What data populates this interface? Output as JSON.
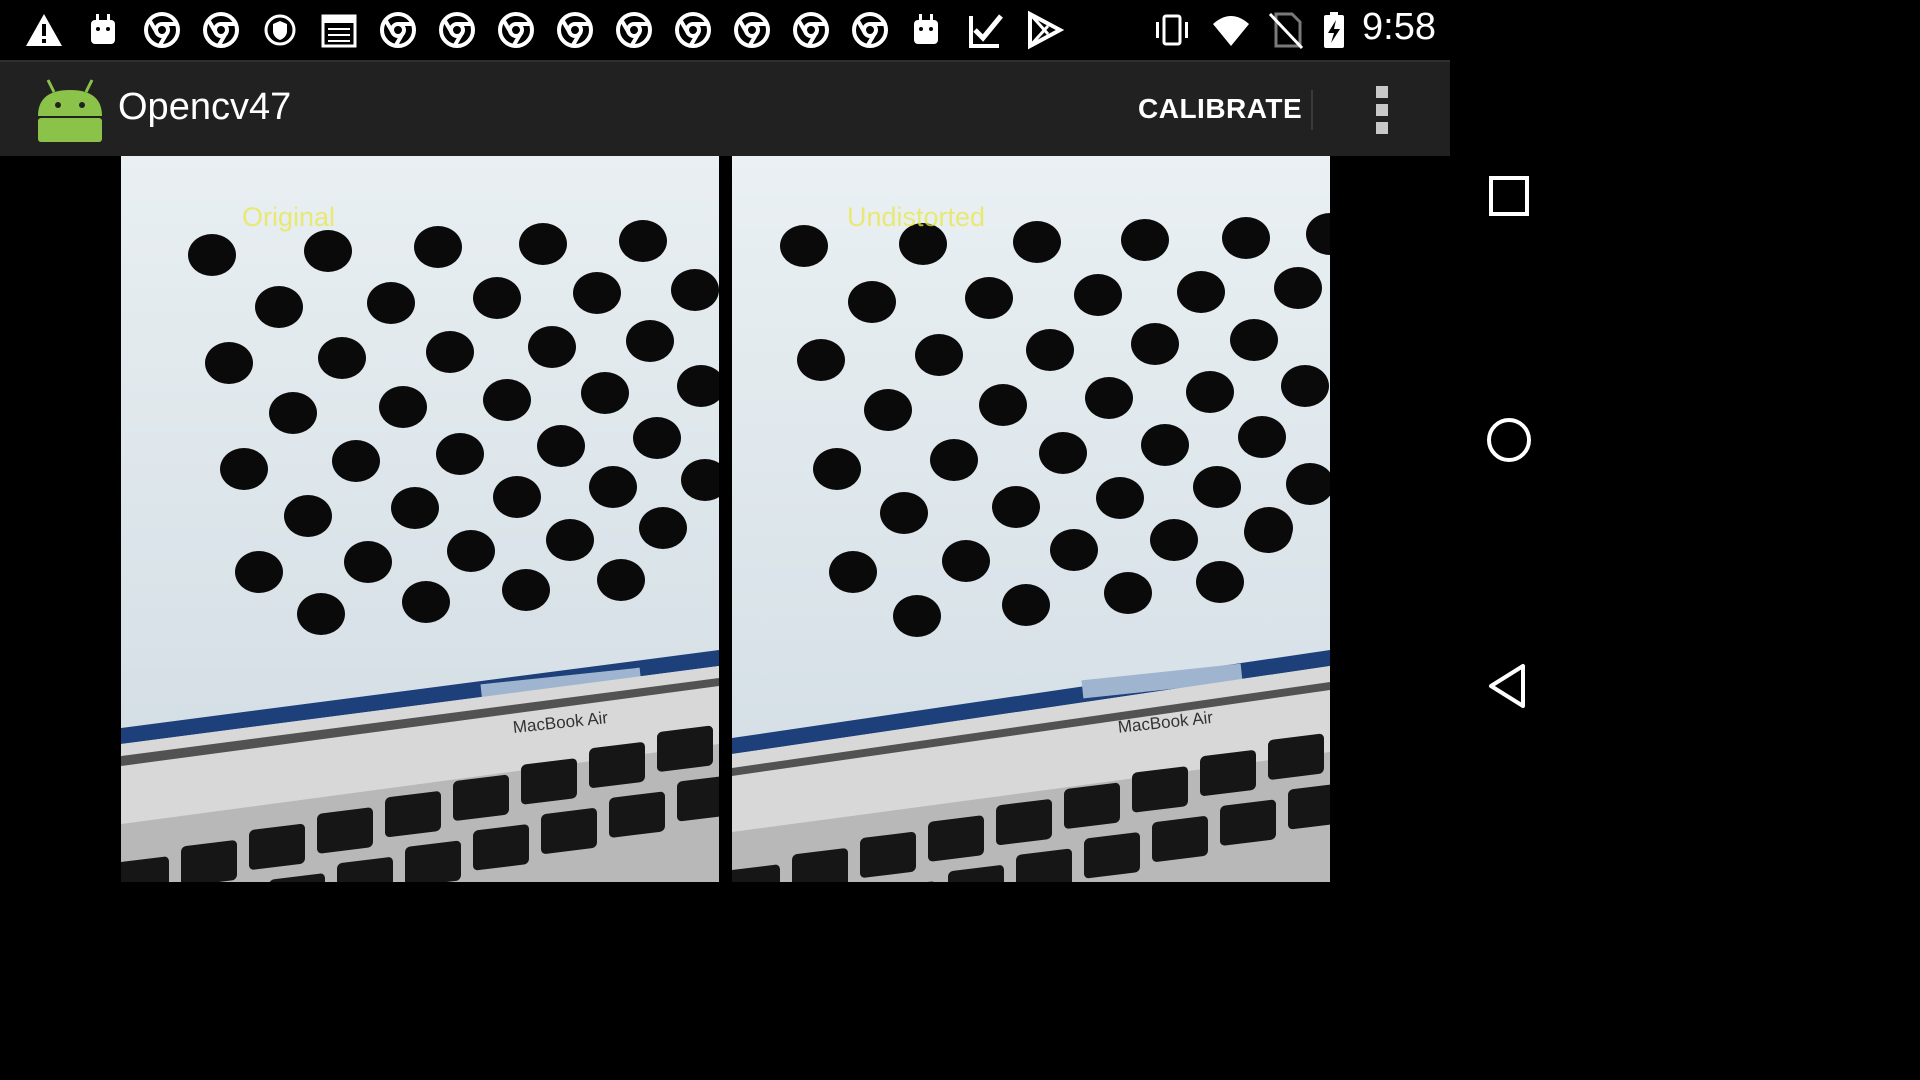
{
  "status_bar": {
    "time": "9:58",
    "left_icons": [
      "warning-icon",
      "android-debug-icon",
      "chrome-icon",
      "chrome-icon",
      "shield-icon",
      "calendar-icon",
      "chrome-icon",
      "chrome-icon",
      "chrome-icon",
      "chrome-icon",
      "chrome-icon",
      "chrome-icon",
      "chrome-icon",
      "chrome-icon",
      "chrome-icon",
      "android-debug-icon",
      "tasks-icon",
      "play-store-icon"
    ],
    "right_icons": [
      "vibrate-icon",
      "wifi-icon",
      "no-sim-icon",
      "battery-charging-icon"
    ]
  },
  "action_bar": {
    "title": "Opencv47",
    "calibrate_label": "CALIBRATE",
    "overflow_icon": "more-vert-icon"
  },
  "frames": {
    "original_label": "Original",
    "undistorted_label": "Undistorted",
    "laptop_label": "MacBook Air"
  },
  "nav_bar": {
    "buttons": [
      "recents-icon",
      "home-icon",
      "back-icon"
    ]
  },
  "colors": {
    "action_bar_bg": "#212121",
    "status_bar_bg": "#000000",
    "overlay_text": "#e8e84a",
    "android_green": "#8bc34a"
  }
}
